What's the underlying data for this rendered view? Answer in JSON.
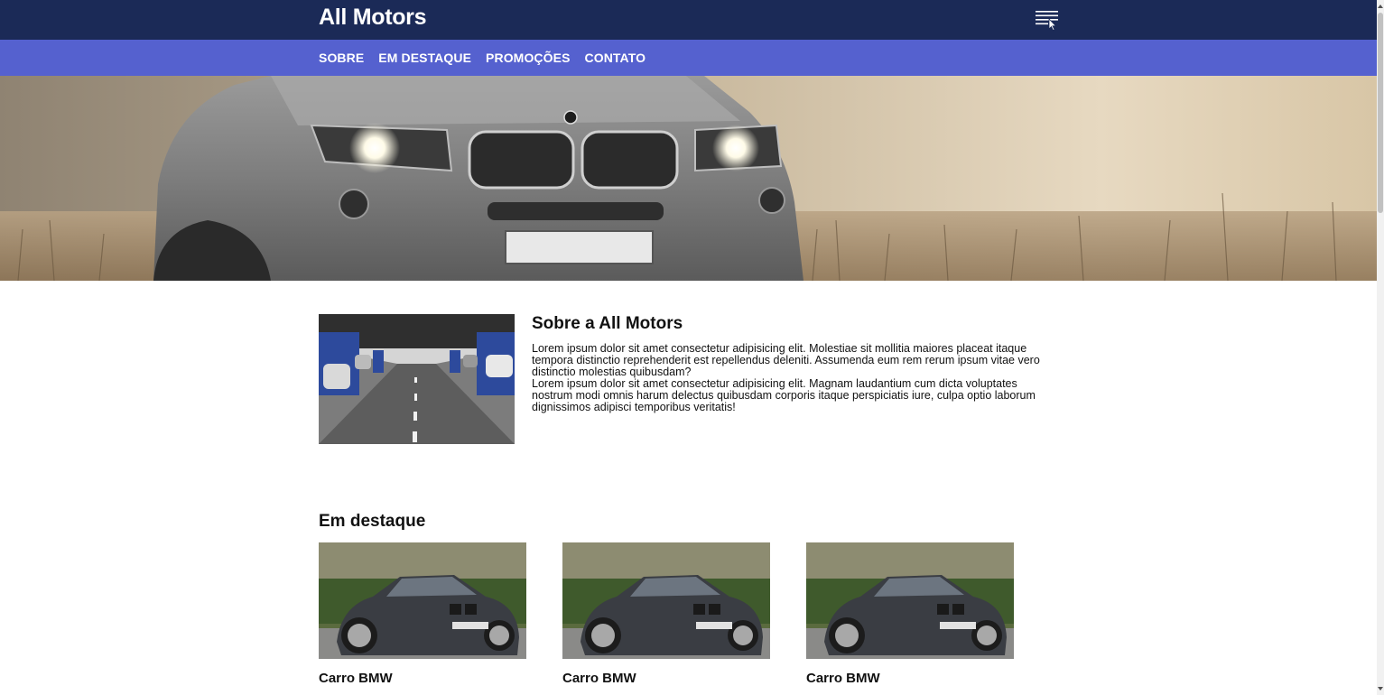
{
  "header": {
    "brand": "All Motors",
    "menu_icon": "hamburger-menu-icon"
  },
  "nav": {
    "items": [
      {
        "label": "SOBRE"
      },
      {
        "label": "EM DESTAQUE"
      },
      {
        "label": "PROMOÇÕES"
      },
      {
        "label": "CONTATO"
      }
    ]
  },
  "hero": {
    "image": "car-front-field-photo"
  },
  "about": {
    "image": "parking-garage-photo",
    "title": "Sobre a All Motors",
    "paragraph1": "Lorem ipsum dolor sit amet consectetur adipisicing elit. Molestiae sit mollitia maiores placeat itaque tempora distinctio reprehenderit est repellendus deleniti. Assumenda eum rem rerum ipsum vitae vero distinctio molestias quibusdam?",
    "paragraph2": "Lorem ipsum dolor sit amet consectetur adipisicing elit. Magnam laudantium cum dicta voluptates nostrum modi omnis harum delectus quibusdam corporis itaque perspiciatis iure, culpa optio laborum dignissimos adipisci temporibus veritatis!"
  },
  "featured": {
    "title": "Em destaque",
    "cards": [
      {
        "title": "Carro BMW",
        "image": "bmw-car-photo"
      },
      {
        "title": "Carro BMW",
        "image": "bmw-car-photo"
      },
      {
        "title": "Carro BMW",
        "image": "bmw-car-photo"
      }
    ]
  },
  "colors": {
    "topbar": "#1b2a57",
    "navbar": "#5561cf"
  }
}
